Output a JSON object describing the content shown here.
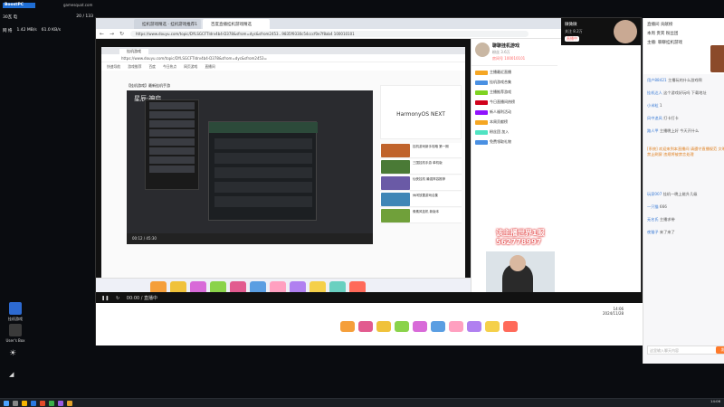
{
  "overlay": {
    "app_label": "BoostPC",
    "site": "gamesquat.com",
    "volume_label": "30瓦 电",
    "fps": "20 / 133",
    "net_label": "网 络",
    "upload": "1.42 MB/s",
    "download": "61.0 KB/s"
  },
  "desktop_icons": [
    {
      "label": "挂机游戏",
      "color": "#2d6ad1"
    },
    {
      "label": "User's Box",
      "color": "#3a3a3a"
    }
  ],
  "browser": {
    "tabs": [
      {
        "label": "挂机游戏精选 · 挂机游戏推荐1"
      },
      {
        "label": "百度直播挂机游戏精选"
      }
    ],
    "url": "https://www.douyu.com/topic/DYLSGCFTldrv4b4-D378&sfrom=dyc&sfrom2453...9835f9330c54cccf0e7f8ab4  100010101"
  },
  "inner_browser": {
    "tab": "挂机游戏",
    "url": "https://www.douyu.com/topic/DYLSGCFTldrv4b4-D378&sfrom=dyc&sfrom2453=",
    "bookmarks": [
      "快速导航",
      "游戏推荐",
      "百度",
      "今日热点",
      "网页游戏",
      "直播间"
    ],
    "video_title": "【挂机游戏】最新挂机手游",
    "game_logo": "星辰·神启",
    "sidebar_brand": "HarmonyOS NEXT",
    "side_items": [
      {
        "text": "挂机游戏新手攻略 第一期",
        "color": "#c0632b"
      },
      {
        "text": "三国挂机手游 单机版",
        "color": "#4a7a36"
      },
      {
        "text": "仙侠挂机 最强阵容推荐",
        "color": "#6a5aa6"
      },
      {
        "text": "休闲放置游戏合集",
        "color": "#3f86b6"
      },
      {
        "text": "像素风挂机 新版本",
        "color": "#70a03a"
      }
    ],
    "video_time": "00:12 / 45:30"
  },
  "stream": {
    "overlay_text": "该主播世界1服",
    "overlay_number": "562778997",
    "streamer_name": "微微微",
    "followers": "关注 8.2万",
    "room_tag": "直播中"
  },
  "right_panel": {
    "streamer": "聊聊挂机游戏",
    "followers": "粉丝 3.6万",
    "room": "房间号 100010101",
    "items": [
      {
        "text": "主播最近直播",
        "color": "#f5a623"
      },
      {
        "text": "挂机游戏合集",
        "color": "#4a90e2"
      },
      {
        "text": "主播推荐游戏",
        "color": "#7ed321"
      },
      {
        "text": "今日直播间热榜",
        "color": "#d0021b"
      },
      {
        "text": "新人福利活动",
        "color": "#9013fe"
      },
      {
        "text": "本周贡献榜",
        "color": "#f5a623"
      },
      {
        "text": "粉丝团 加入",
        "color": "#50e3c2"
      },
      {
        "text": "免费领取礼物",
        "color": "#4a90e2"
      }
    ]
  },
  "chat": {
    "header_rows": [
      "直播间 贡献榜",
      "本周 贵宾 粉丝团",
      "主播: 聊聊挂机游戏"
    ],
    "lines": [
      {
        "user": "用户88421",
        "text": "主播玩的什么游戏啊",
        "hl": false
      },
      {
        "user": "挂机达人",
        "text": "这个游戏好玩吗 下载地址",
        "hl": false
      },
      {
        "user": "小米粒",
        "text": "1",
        "hl": false
      },
      {
        "user": "风中追风",
        "text": "打卡打卡",
        "hl": false
      },
      {
        "user": "路人甲",
        "text": "主播晚上好 今天开什么",
        "hl": false
      },
      {
        "user": "[系统]",
        "text": "欢迎来到本直播间 请遵守直播规范 文明发言 禁止刷屏 违规将被禁言处理",
        "hl": true
      },
      {
        "user": "玩家007",
        "text": "挂机一晚上能升几级",
        "hl": false
      },
      {
        "user": "一只猫",
        "text": "666",
        "hl": false
      },
      {
        "user": "无名氏",
        "text": "主播求带",
        "hl": false
      },
      {
        "user": "夜猫子",
        "text": "来了来了",
        "hl": false
      }
    ],
    "input_placeholder": "这里输入聊天内容",
    "send_label": "发送"
  },
  "player": {
    "bar_text": "00:00 / 直播中",
    "clock_time": "14:06",
    "clock_date": "2024/11/28"
  }
}
